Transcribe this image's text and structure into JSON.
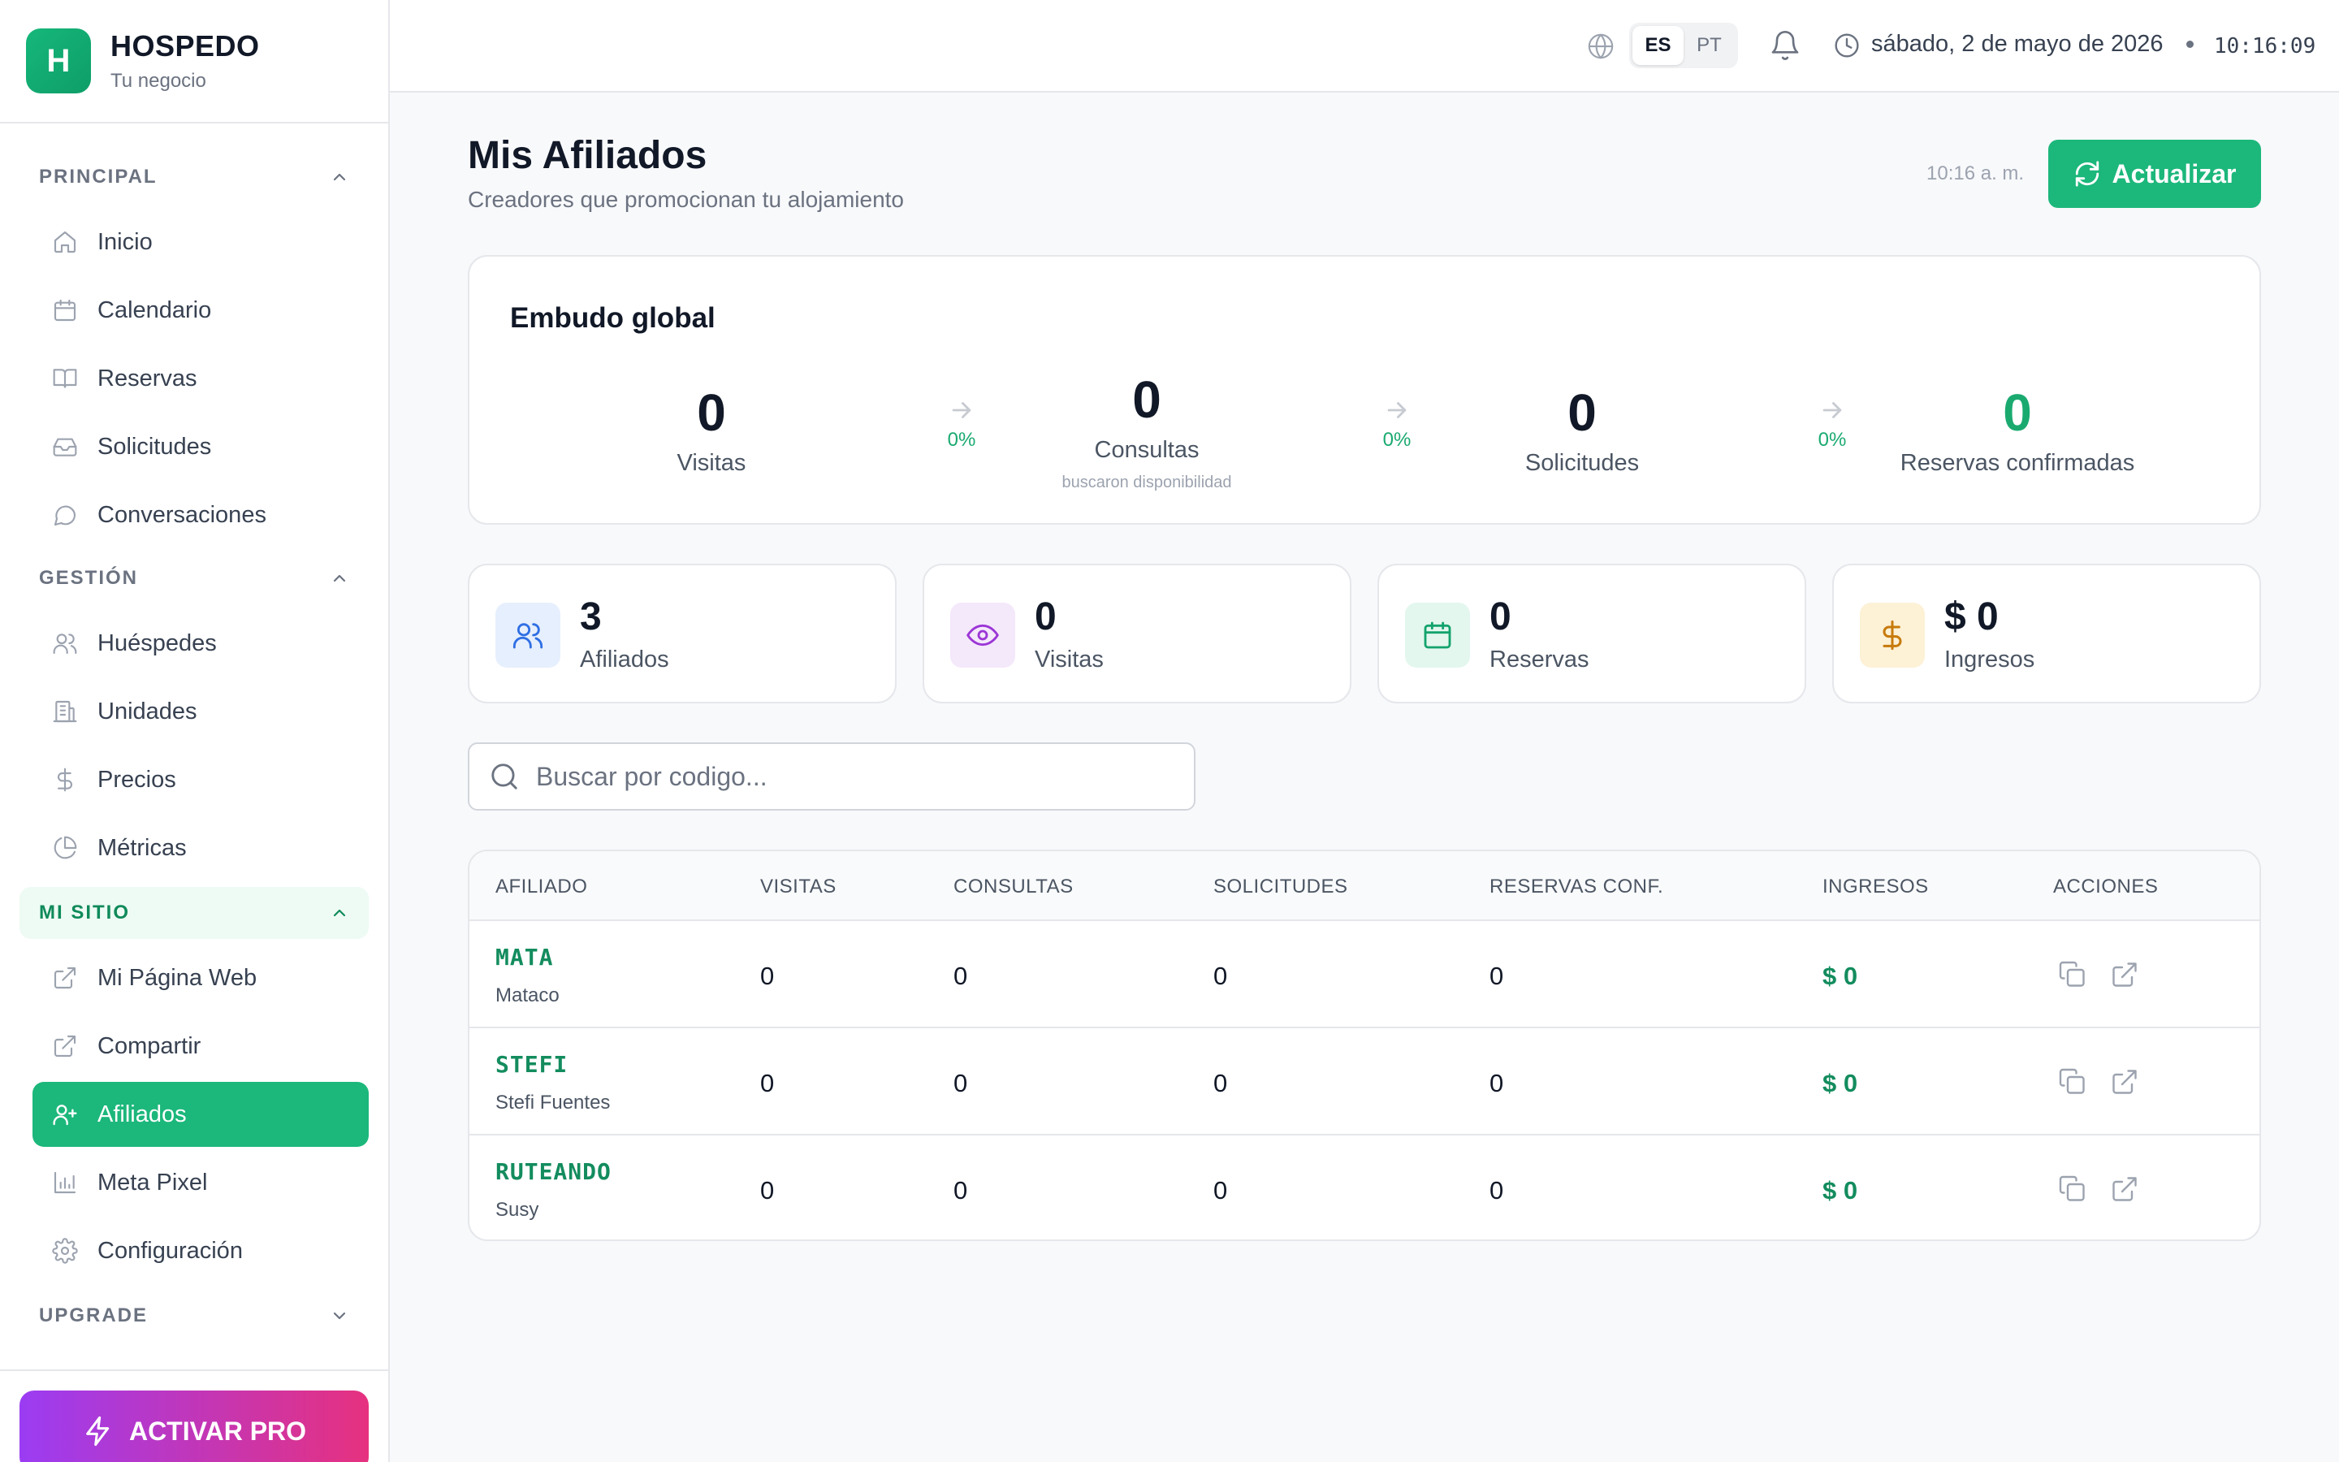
{
  "brand": {
    "logo_letter": "H",
    "name": "HOSPEDO",
    "tagline": "Tu negocio"
  },
  "sidebar": {
    "sections": [
      {
        "id": "principal",
        "label": "PRINCIPAL",
        "expanded": true
      },
      {
        "id": "gestion",
        "label": "GESTIÓN",
        "expanded": true
      },
      {
        "id": "mi-sitio",
        "label": "MI SITIO",
        "expanded": true
      },
      {
        "id": "upgrade",
        "label": "UPGRADE",
        "expanded": false
      }
    ],
    "items": [
      {
        "label": "Inicio",
        "icon": "home-icon"
      },
      {
        "label": "Calendario",
        "icon": "calendar-icon"
      },
      {
        "label": "Reservas",
        "icon": "book-icon"
      },
      {
        "label": "Solicitudes",
        "icon": "inbox-icon"
      },
      {
        "label": "Conversaciones",
        "icon": "chat-icon"
      },
      {
        "label": "Huéspedes",
        "icon": "users-icon"
      },
      {
        "label": "Unidades",
        "icon": "building-icon"
      },
      {
        "label": "Precios",
        "icon": "dollar-icon"
      },
      {
        "label": "Métricas",
        "icon": "pie-chart-icon"
      },
      {
        "label": "Mi Página Web",
        "icon": "external-link-icon"
      },
      {
        "label": "Compartir",
        "icon": "share-icon"
      },
      {
        "label": "Afiliados",
        "icon": "user-plus-icon",
        "active": true
      },
      {
        "label": "Meta Pixel",
        "icon": "bar-chart-icon"
      },
      {
        "label": "Configuración",
        "icon": "gear-icon"
      }
    ],
    "pro_button": "ACTIVAR PRO"
  },
  "topbar": {
    "languages": [
      "ES",
      "PT"
    ],
    "active_language": "ES",
    "date": "sábado, 2 de mayo de 2026",
    "time": "10:16:09"
  },
  "header": {
    "title": "Mis Afiliados",
    "subtitle": "Creadores que promocionan tu alojamiento",
    "updated_at": "10:16 a. m.",
    "refresh_label": "Actualizar"
  },
  "funnel": {
    "title": "Embudo global",
    "stages": [
      {
        "value": "0",
        "label": "Visitas",
        "hint": ""
      },
      {
        "value": "0",
        "label": "Consultas",
        "hint": "buscaron disponibilidad"
      },
      {
        "value": "0",
        "label": "Solicitudes",
        "hint": ""
      },
      {
        "value": "0",
        "label": "Reservas confirmadas",
        "hint": ""
      }
    ],
    "conversions": [
      "0%",
      "0%",
      "0%"
    ]
  },
  "stats": [
    {
      "value": "3",
      "label": "Afiliados",
      "icon": "users-icon",
      "color": "#2f6fe4",
      "bg": "#e6effd"
    },
    {
      "value": "0",
      "label": "Visitas",
      "icon": "eye-icon",
      "color": "#9b35d6",
      "bg": "#f4e8fb"
    },
    {
      "value": "0",
      "label": "Reservas",
      "icon": "calendar-icon",
      "color": "#13a36c",
      "bg": "#e3f7ee"
    },
    {
      "value": "$ 0",
      "label": "Ingresos",
      "icon": "dollar-icon",
      "color": "#c77a0a",
      "bg": "#fdf1d6"
    }
  ],
  "search": {
    "placeholder": "Buscar por codigo...",
    "value": ""
  },
  "table": {
    "columns": [
      "AFILIADO",
      "VISITAS",
      "CONSULTAS",
      "SOLICITUDES",
      "RESERVAS CONF.",
      "INGRESOS",
      "ACCIONES"
    ],
    "rows": [
      {
        "code": "MATA",
        "name": "Mataco",
        "visitas": "0",
        "consultas": "0",
        "solicitudes": "0",
        "reservas": "0",
        "ingresos": "$ 0"
      },
      {
        "code": "STEFI",
        "name": "Stefi Fuentes",
        "visitas": "0",
        "consultas": "0",
        "solicitudes": "0",
        "reservas": "0",
        "ingresos": "$ 0"
      },
      {
        "code": "RUTEANDO",
        "name": "Susy",
        "visitas": "0",
        "consultas": "0",
        "solicitudes": "0",
        "reservas": "0",
        "ingresos": "$ 0"
      }
    ],
    "row_actions": [
      "copy-icon",
      "external-link-icon"
    ]
  },
  "colors": {
    "accent": "#1cb77b",
    "accent_dark": "#138c5e",
    "pro_gradient": [
      "#9b3cf3",
      "#e6317f"
    ]
  }
}
